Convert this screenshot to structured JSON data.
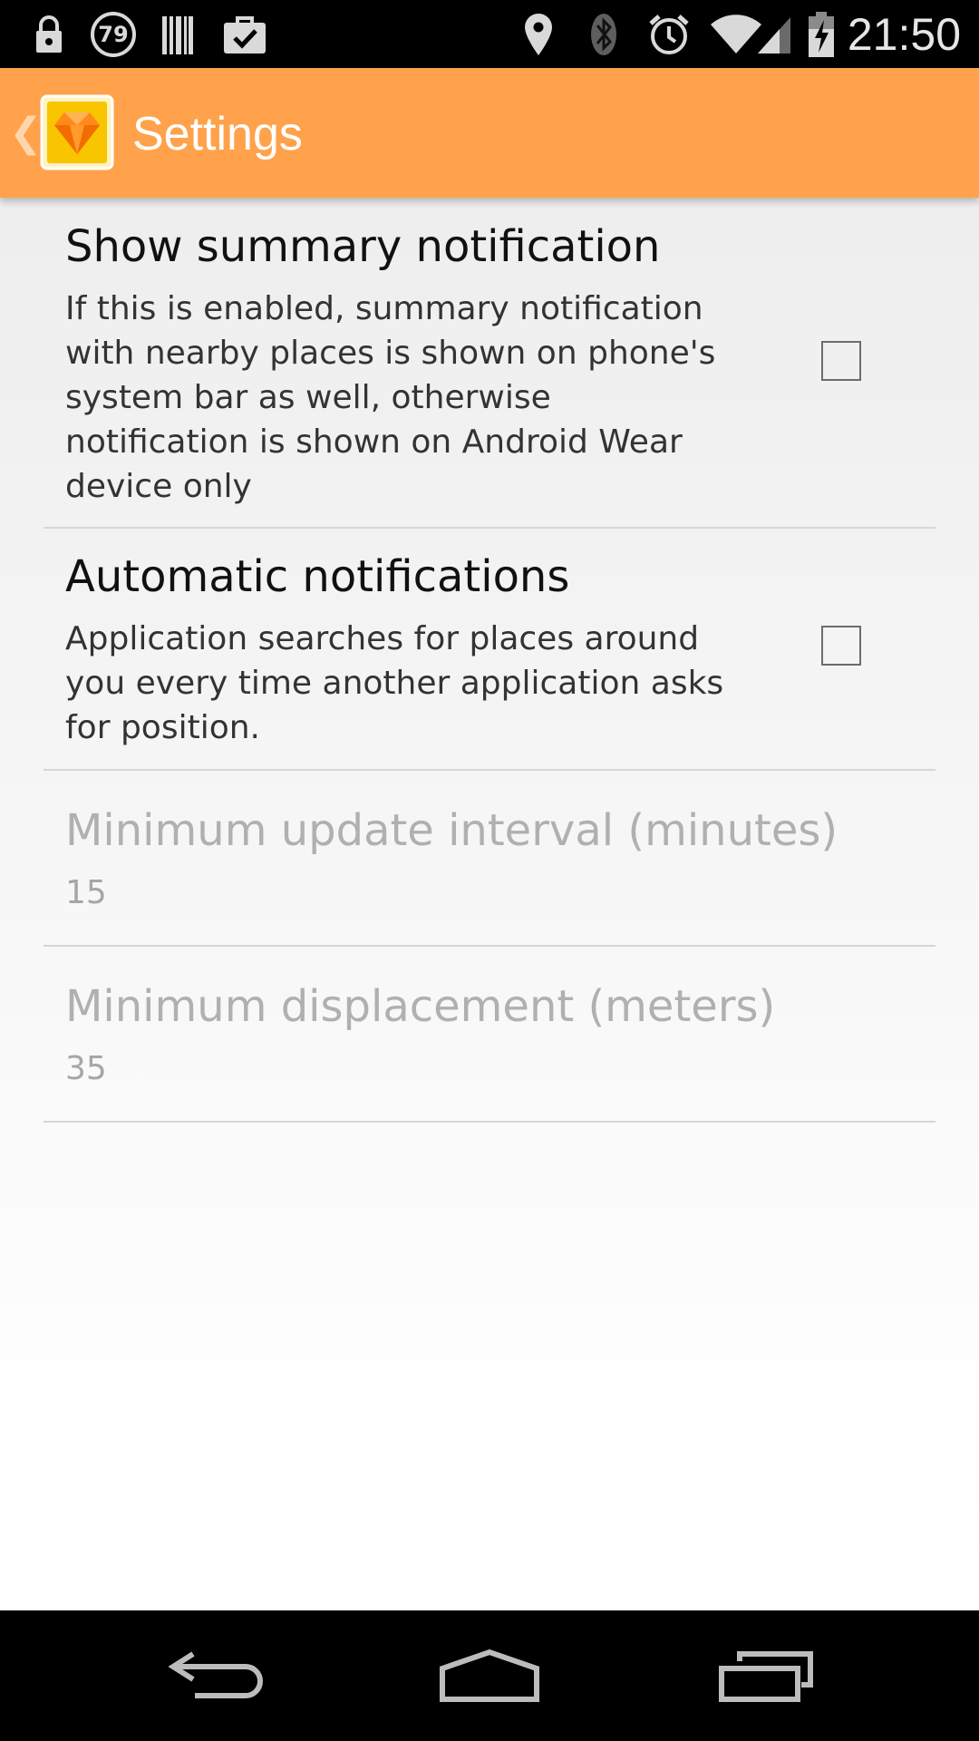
{
  "status_bar": {
    "time": "21:50",
    "notification_badge": "79",
    "icons": [
      "lock-icon",
      "badge-icon",
      "barcode-icon",
      "shopping-bag-check-icon",
      "location-pin-icon",
      "bluetooth-icon",
      "alarm-icon",
      "wifi-icon",
      "cell-signal-icon",
      "battery-charging-icon"
    ]
  },
  "action_bar": {
    "title": "Settings",
    "up_caret": "❮",
    "background_color": "#ffa24b"
  },
  "preferences": [
    {
      "title": "Show summary notification",
      "summary_lines": [
        "If this is enabled, summary notification",
        "with nearby places is shown on phone's",
        "system bar as well, otherwise",
        "notification is shown on Android Wear",
        "device only"
      ],
      "checked": false,
      "enabled": true
    },
    {
      "title": "Automatic notifications",
      "summary_lines": [
        "Application searches for places around",
        "you every time another application asks",
        "for position."
      ],
      "checked": false,
      "enabled": true
    },
    {
      "title": "Minimum update interval (minutes)",
      "value": "15",
      "enabled": false
    },
    {
      "title": "Minimum displacement (meters)",
      "value": "35",
      "enabled": false
    }
  ],
  "nav_bar": {
    "buttons": [
      "back-icon",
      "home-icon",
      "recents-icon"
    ]
  }
}
